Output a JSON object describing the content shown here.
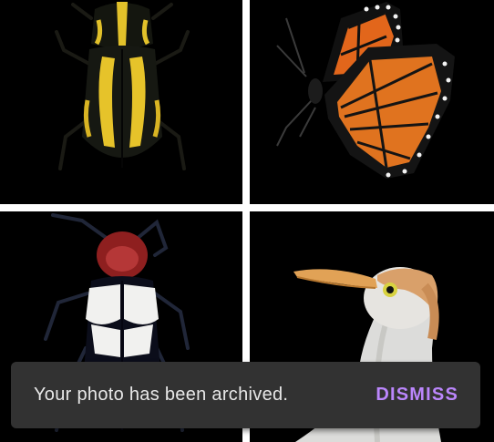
{
  "gallery": {
    "photos": [
      {
        "subject": "beetle-black-yellow"
      },
      {
        "subject": "monarch-butterfly"
      },
      {
        "subject": "beetle-red-white"
      },
      {
        "subject": "cattle-egret"
      }
    ]
  },
  "snackbar": {
    "message": "Your photo has been archived.",
    "action_label": "DISMISS",
    "background": "#323232",
    "action_color": "#bb86fc"
  }
}
